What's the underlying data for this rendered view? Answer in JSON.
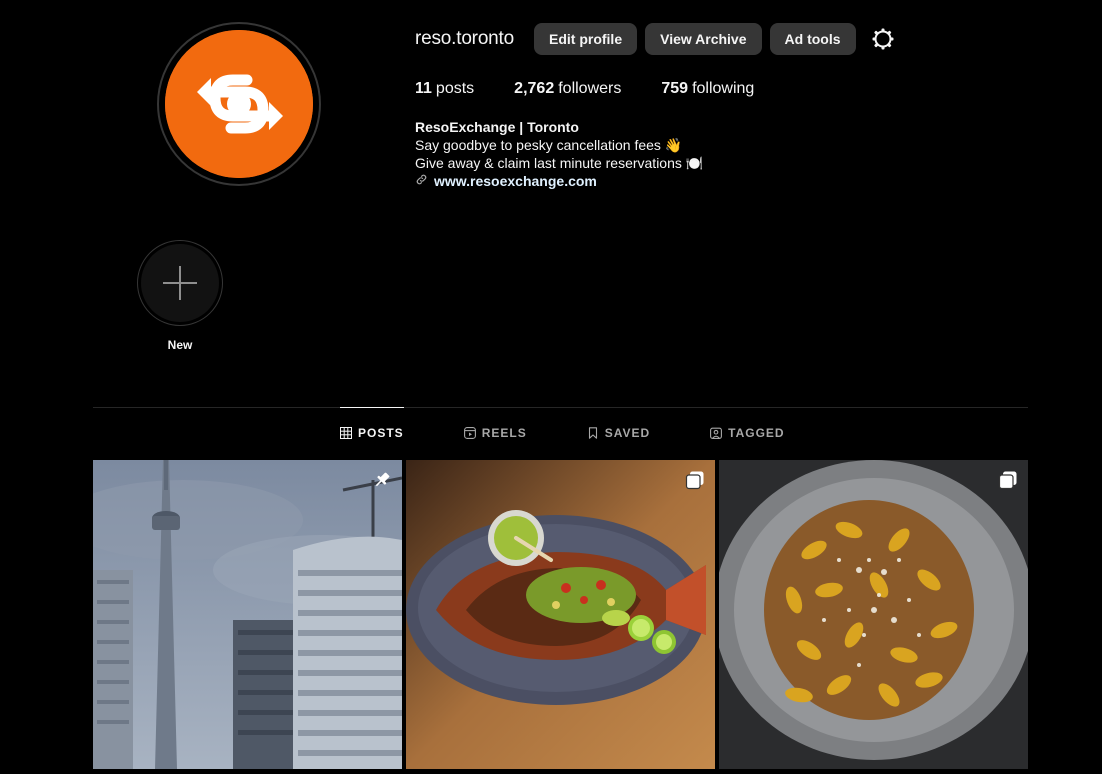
{
  "profile": {
    "username": "reso.toronto",
    "buttons": {
      "edit_profile": "Edit profile",
      "view_archive": "View Archive",
      "ad_tools": "Ad tools"
    },
    "stats": {
      "posts_count": "11",
      "posts_label": "posts",
      "followers_count": "2,762",
      "followers_label": "followers",
      "following_count": "759",
      "following_label": "following"
    },
    "bio": {
      "name": "ResoExchange | Toronto",
      "line1": "Say goodbye to pesky cancellation fees 👋",
      "line2": "Give away & claim last minute reservations 🍽️",
      "link": "www.resoexchange.com"
    },
    "avatar_color": "#f26a0f"
  },
  "highlights": [
    {
      "label": "New"
    }
  ],
  "tabs": [
    {
      "label": "POSTS",
      "icon": "grid-icon",
      "active": true
    },
    {
      "label": "REELS",
      "icon": "reels-icon",
      "active": false
    },
    {
      "label": "SAVED",
      "icon": "bookmark-icon",
      "active": false
    },
    {
      "label": "TAGGED",
      "icon": "tagged-icon",
      "active": false
    }
  ],
  "posts": [
    {
      "subject": "cn-tower-city",
      "badge": "pin-icon"
    },
    {
      "subject": "grilled-fish-platter",
      "badge": "carousel-icon"
    },
    {
      "subject": "cavatelli-pasta",
      "badge": "carousel-icon"
    }
  ]
}
